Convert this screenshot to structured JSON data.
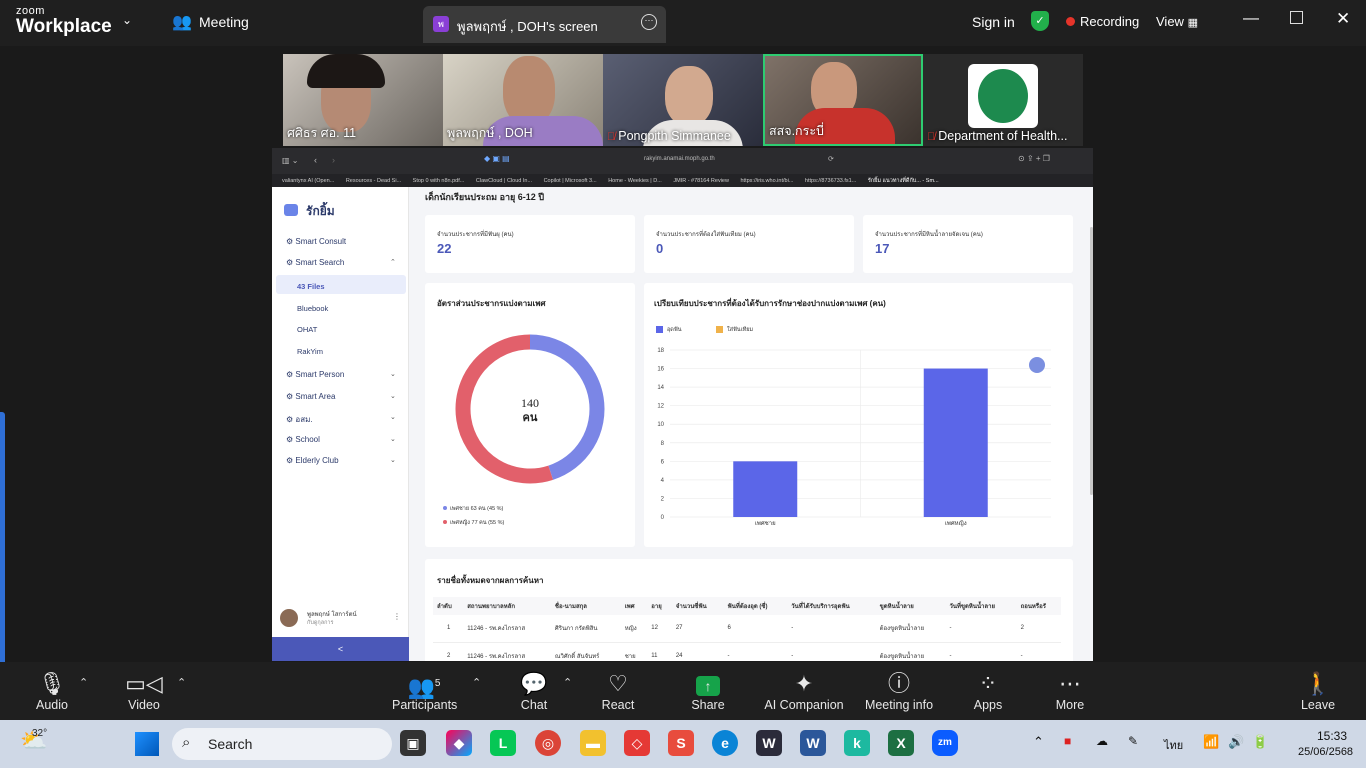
{
  "zoom": {
    "logo_small": "zoom",
    "logo_big": "Workplace",
    "meeting_label": "Meeting",
    "share_tab_title": "พูลพฤกษ์ , DOH's screen",
    "sign_in": "Sign in",
    "recording": "Recording",
    "view": "View",
    "participants_tiles": [
      {
        "name": "ศศิธร ศอ. 11",
        "muted": false
      },
      {
        "name": "พูลพฤกษ์ , DOH",
        "muted": false
      },
      {
        "name": "Pongpith Simmanee",
        "muted": true
      },
      {
        "name": "สสจ.กระบี่",
        "muted": false
      },
      {
        "name": "Department of Health...",
        "muted": true
      }
    ],
    "participants_count": "5",
    "bottom": {
      "audio": "Audio",
      "video": "Video",
      "participants": "Participants",
      "chat": "Chat",
      "react": "React",
      "share": "Share",
      "ai_companion": "AI Companion",
      "meeting_info": "Meeting info",
      "apps": "Apps",
      "more": "More",
      "leave": "Leave"
    }
  },
  "browser": {
    "url": "rakyim.anamai.moph.go.th",
    "bookmarks": [
      "valiantynx AI (Open...",
      "Resources - Dead Si...",
      "Stop 0 with n8n.pdf...",
      "ClawCloud | Cloud In...",
      "Copilot | Microsoft 3...",
      "Home - Weekies | D...",
      "JMIR - #78164 Review",
      "https://iris.who.int/bi...",
      "https://8736733.fs1...",
      "รักยิ้ม แนวทางที่ดีกับ... - Sm..."
    ]
  },
  "app": {
    "brand": "รักยิ้ม",
    "nav": [
      {
        "label": "Smart Consult",
        "chevron": ""
      },
      {
        "label": "Smart Search",
        "chevron": "up"
      },
      {
        "label": "Smart Person",
        "chevron": "down"
      },
      {
        "label": "Smart Area",
        "chevron": "down"
      },
      {
        "label": "อสม.",
        "chevron": "down"
      },
      {
        "label": "School",
        "chevron": "down"
      },
      {
        "label": "Elderly Club",
        "chevron": "down"
      }
    ],
    "subnav": [
      "43 Files",
      "Bluebook",
      "OHAT",
      "RakYim"
    ],
    "user_name": "พูลพฤกษ์ โสการ์ตน์",
    "user_role": "กับดูกุลการ",
    "collapse": "<",
    "section_title": "เด็กนักเรียนประถม อายุ 6-12 ปี",
    "stats": [
      {
        "label": "จำนวนประชากรที่มีฟันผุ (คน)",
        "value": "22"
      },
      {
        "label": "จำนวนประชากรที่ต้องใส่ฟันเทียม (คน)",
        "value": "0"
      },
      {
        "label": "จำนวนประชากรที่มีหินน้ำลายจัดเจน (คน)",
        "value": "17"
      }
    ],
    "donut": {
      "title": "อัตราส่วนประชากรแบ่งตามเพศ",
      "center_value": "140",
      "center_unit": "คน",
      "legend": [
        {
          "label": "เพศชาย 63 คน (45 %)",
          "color": "#7b86e6"
        },
        {
          "label": "เพศหญิง 77 คน (55 %)",
          "color": "#e2606b"
        }
      ]
    },
    "table": {
      "title": "รายชื่อทั้งหมดจากผลการค้นหา",
      "headers": [
        "ลำดับ",
        "สถานพยาบาลหลัก",
        "ชื่อ-นามสกุล",
        "เพศ",
        "อายุ",
        "จำนวนซี่ฟัน",
        "ฟันที่ต้องอุด (ซี่)",
        "วันที่ได้รับบริการอุดฟัน",
        "ขูดหินน้ำลาย",
        "วันที่ขูดหินน้ำลาย",
        "ถอนหรือรั"
      ],
      "rows": [
        [
          "1",
          "11246 - รพ.คงไกรลาส",
          "ศิรินภา กรัดพิสิน",
          "หญิง",
          "12",
          "27",
          "6",
          "-",
          "ต้องขูดหินน้ำลาย",
          "-",
          "2"
        ],
        [
          "2",
          "11246 - รพ.คงไกรลาส",
          "ณวิศักดิ์ สันจันทร์",
          "ชาย",
          "11",
          "24",
          "-",
          "-",
          "ต้องขูดหินน้ำลาย",
          "-",
          "-"
        ]
      ]
    }
  },
  "chart_data": [
    {
      "type": "pie",
      "title": "อัตราส่วนประชากรแบ่งตามเพศ",
      "categories": [
        "เพศชาย",
        "เพศหญิง"
      ],
      "values": [
        63,
        77
      ],
      "colors": [
        "#7b86e6",
        "#e2606b"
      ],
      "donut": true,
      "center_label": "140 คน"
    },
    {
      "type": "bar",
      "title": "เปรียบเทียบประชากรที่ต้องได้รับการรักษาช่องปากแบ่งตามเพศ (คน)",
      "categories": [
        "เพศชาย",
        "เพศหญิง"
      ],
      "series": [
        {
          "name": "อุดฟัน",
          "values": [
            6,
            16
          ],
          "color": "#5b66e8"
        },
        {
          "name": "ใส่ฟันเทียม",
          "values": [
            0,
            0
          ],
          "color": "#f0b24a"
        }
      ],
      "ylim": [
        0,
        18
      ],
      "yticks": [
        0,
        2,
        4,
        6,
        8,
        10,
        12,
        14,
        16,
        18
      ],
      "grid": true,
      "legend": "top-left"
    }
  ],
  "taskbar": {
    "temperature": "32°",
    "search": "Search",
    "lang": "ไทย",
    "time": "15:33",
    "date": "25/06/2568"
  },
  "colors": {
    "accent": "#4b58b8",
    "zoom_share_green": "#16a34a",
    "active_tile_border": "#2ecc71",
    "recording_red": "#e5342a"
  }
}
